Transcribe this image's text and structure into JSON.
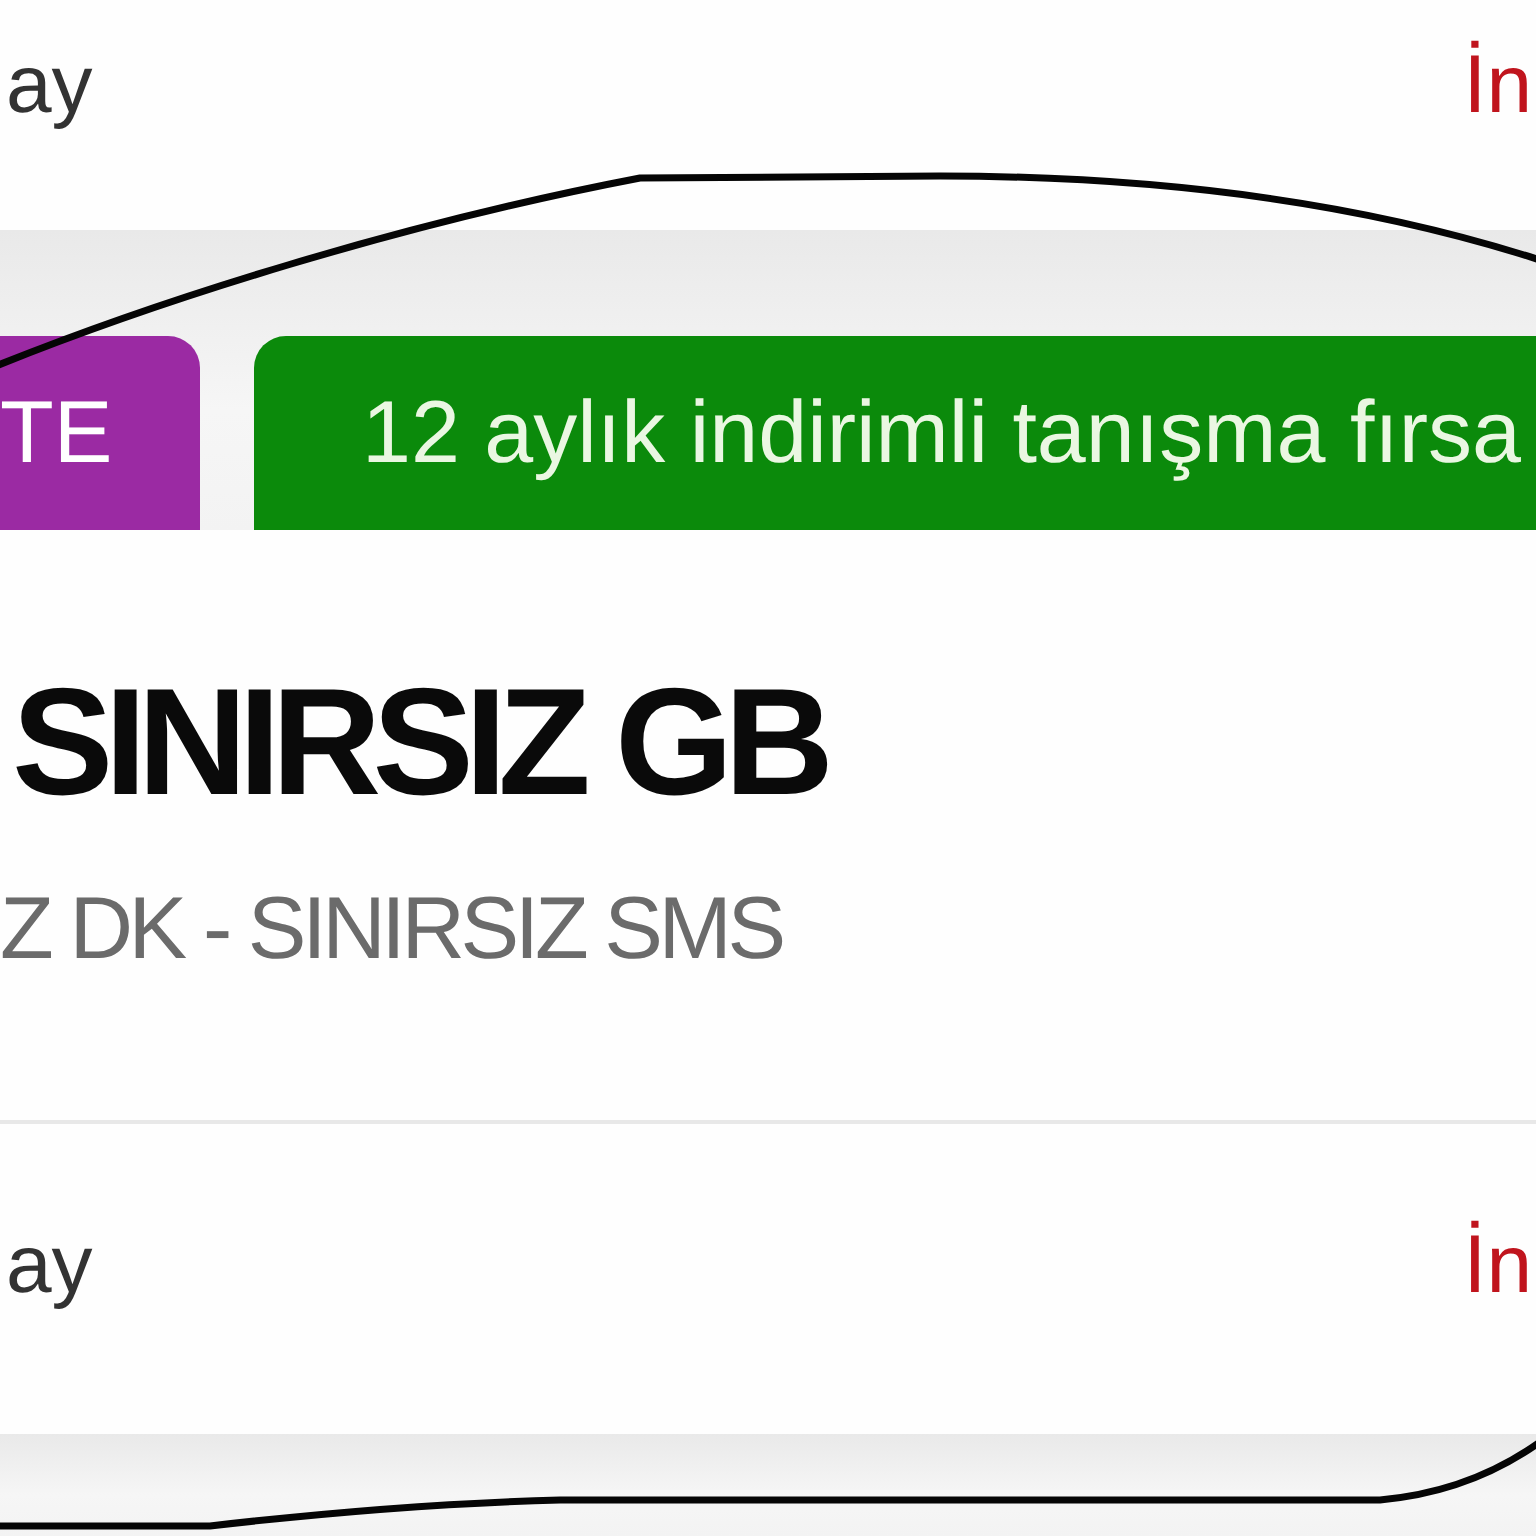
{
  "top_row": {
    "label": "ay",
    "link": "İn"
  },
  "card": {
    "tags": [
      {
        "label": "TE",
        "color": "#9b2aa3"
      },
      {
        "label": "12 aylık indirimli tanışma fırsa",
        "color": "#0b8a0b"
      }
    ],
    "title": "SINIRSIZ GB",
    "subtitle": "Z DK - SINIRSIZ SMS",
    "circled": true
  },
  "bottom_row": {
    "label": "ay",
    "link": "İn"
  }
}
